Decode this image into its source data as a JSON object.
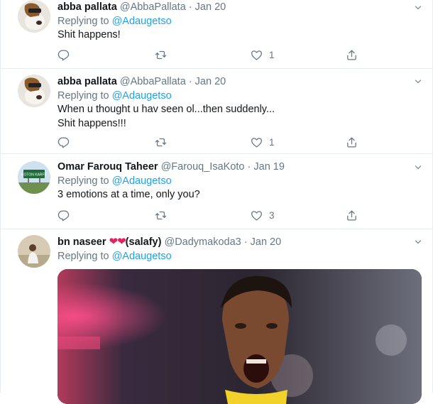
{
  "tweets": [
    {
      "name": "abba pallata",
      "handle": "@AbbaPallata",
      "dot": "·",
      "time": "Jan 20",
      "replying_prefix": "Replying to ",
      "replying_to": "@Adaugetso",
      "text": "Shit happens!",
      "reply_count": "",
      "retweet_count": "",
      "like_count": "1"
    },
    {
      "name": "abba pallata",
      "handle": "@AbbaPallata",
      "dot": "·",
      "time": "Jan 20",
      "replying_prefix": "Replying to ",
      "replying_to": "@Adaugetso",
      "text": "When u thought u hav seen ol...then suddenly...\nShit happens!!!",
      "reply_count": "",
      "retweet_count": "",
      "like_count": "1"
    },
    {
      "name": "Omar Farouq Taheer",
      "handle": "@Farouq_IsaKoto",
      "dot": "·",
      "time": "Jan 19",
      "replying_prefix": "Replying to ",
      "replying_to": "@Adaugetso",
      "text": "3 emotions at a time, only you?",
      "reply_count": "",
      "retweet_count": "",
      "like_count": "3",
      "avatar_sign_text": "KOTON KARFE"
    },
    {
      "name": "bn naseer",
      "name_emoji": "❤❤",
      "name_suffix": "(salafy)",
      "handle": "@Dadymakoda3",
      "dot": "·",
      "time": "Jan 20",
      "replying_prefix": "Replying to ",
      "replying_to": "@Adaugetso"
    }
  ],
  "icons": {
    "caret": "chevron-down-icon",
    "reply": "reply-icon",
    "retweet": "retweet-icon",
    "like": "heart-icon",
    "share": "share-icon"
  },
  "colors": {
    "link": "#1da1f2",
    "secondary": "#657786",
    "heart_emoji": "#e0245e",
    "divider": "#e6ecf0"
  }
}
